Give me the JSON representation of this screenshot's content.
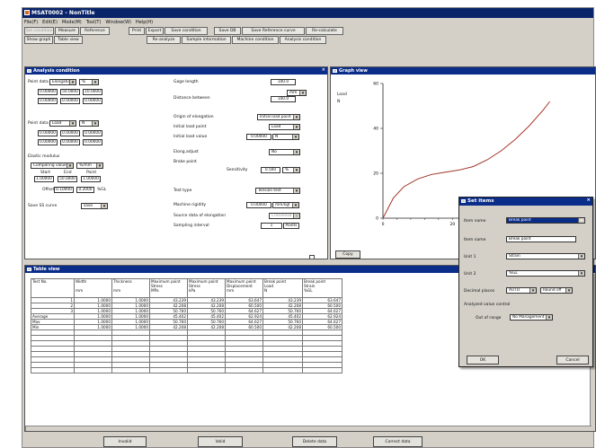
{
  "window": {
    "title": "MSAT0002 - NonTitle"
  },
  "menu": [
    "File(F)",
    "Edit(E)",
    "Mode(M)",
    "Tool(T)",
    "Window(W)",
    "Help(H)"
  ],
  "toolbar1": [
    "Set condition",
    "Measure",
    "Reference",
    "Print",
    "Export",
    "Save condition",
    "Save DB",
    "Save Reference curve",
    "Re-calculate"
  ],
  "toolbar2": [
    "Show graph",
    "Table view",
    "Re-analyze",
    "Sample information",
    "Machine condition",
    "Analysis condition"
  ],
  "analysis": {
    "title": "Analysis condition",
    "point1": {
      "label": "Point data",
      "type": "Elongation",
      "unit": "%",
      "v1": "0.00000",
      "v2": "50.0000",
      "v3": "10.0000",
      "v4": "0.00000",
      "v5": "0.00000",
      "v6": "0.00000"
    },
    "point2": {
      "label": "Point data",
      "type": "Load",
      "unit": "N",
      "v1": "0.00000",
      "v2": "0.00000",
      "v3": "0.00000",
      "v4": "0.00000",
      "v5": "0.00000",
      "v6": "0.00000"
    },
    "elastic": {
      "label": "Elastic modulus",
      "type": "Comparing value",
      "range": "%/mm",
      "start_label": "Start",
      "end_label": "End",
      "point_label": "Point",
      "start": "1.00000",
      "end": "50.0000",
      "point": "1.00000",
      "offset_label": "Offset",
      "offset": "0.10000",
      "offset2": "0.2000",
      "offset_unit": "%GL"
    },
    "save_curve": {
      "label": "Save SS curve",
      "value": "save"
    },
    "gage_length": {
      "label": "Gage length",
      "value": "100.0"
    },
    "distance": {
      "label": "Distance between",
      "value": "100.0",
      "unit": "mm"
    },
    "origin": {
      "label": "Origin of elongation",
      "value": "Initial load point"
    },
    "initial_load_point": {
      "label": "Initial load point",
      "value": "Load"
    },
    "initial_load_value": {
      "label": "Initial load value",
      "value": "0.00000",
      "unit": "N"
    },
    "elong_adjust": {
      "label": "Elong.adjust",
      "value": "No"
    },
    "break_point": {
      "label": "Brake point"
    },
    "sensitivity": {
      "label": "Sensitivity",
      "value": "0.500",
      "unit": "%"
    },
    "test_type": {
      "label": "Test type",
      "value": "Tension test"
    },
    "rigidity": {
      "label": "Machine rigidity",
      "value": "0.00000",
      "unit": "mm/kgf"
    },
    "source": {
      "label": "Source data of elongation",
      "value": "Crosshead"
    },
    "sampling": {
      "label": "Sampling interval",
      "value": "1",
      "unit": "Points"
    }
  },
  "graph": {
    "title": "Graph view",
    "ylabel": "Load",
    "yunit": "N",
    "copy_label": "Copy"
  },
  "chart_data": {
    "type": "line",
    "title": "",
    "xlabel": "",
    "ylabel": "Load N",
    "x_ticks": [
      "0",
      "20"
    ],
    "y_ticks": [
      "0",
      "20",
      "40",
      "60"
    ],
    "ylim": [
      0,
      60
    ],
    "xlim": [
      0,
      60
    ],
    "series": [
      {
        "name": "",
        "x": [
          0,
          3,
          6,
          10,
          14,
          18,
          22,
          26,
          30,
          34,
          38,
          42,
          46,
          48
        ],
        "y": [
          0,
          9,
          14,
          17.5,
          19.5,
          20.5,
          21.5,
          23,
          26,
          30,
          35,
          41,
          48,
          52
        ]
      }
    ],
    "grid": false
  },
  "table": {
    "title": "Table view",
    "headers": [
      [
        "Test No.",
        "",
        ""
      ],
      [
        "Width",
        "",
        "mm"
      ],
      [
        "Thickness",
        "",
        "mm"
      ],
      [
        "Maximum point",
        "Stress",
        "MPa"
      ],
      [
        "Maximum point",
        "Stress",
        "kPa"
      ],
      [
        "Maximum point",
        "Displacement",
        "mm"
      ],
      [
        "Break point",
        "Load",
        "N"
      ],
      [
        "Break point",
        "Strain",
        "%GL"
      ]
    ],
    "rows": [
      [
        "1",
        "1.0000",
        "1.0000",
        "43.239",
        "43.239",
        "63.647",
        "43.239",
        "63.647"
      ],
      [
        "2",
        "1.0000",
        "1.0000",
        "42.208",
        "42.208",
        "60.500",
        "42.208",
        "60.500"
      ],
      [
        "3",
        "1.0000",
        "1.0000",
        "50.760",
        "50.760",
        "64.627",
        "50.760",
        "64.627"
      ],
      [
        "Average",
        "1.0000",
        "1.0000",
        "45.402",
        "45.402",
        "62.924",
        "45.402",
        "62.924"
      ],
      [
        "Max",
        "1.0000",
        "1.0000",
        "50.760",
        "50.760",
        "64.627",
        "50.760",
        "64.627"
      ],
      [
        "Min",
        "1.0000",
        "1.0000",
        "42.208",
        "42.208",
        "60.500",
        "42.208",
        "60.500"
      ]
    ]
  },
  "bottom_buttons": [
    "Invalid",
    "Valid",
    "Delete data",
    "Correct data"
  ],
  "dialog": {
    "title": "Set items",
    "item_name_label": "Item name",
    "item_name": "Break point",
    "item_name2_label": "Item name",
    "item_name2": "Break point",
    "unit1_label": "Unit 1",
    "unit1": "Strain",
    "unit2_label": "Unit 2",
    "unit2": "%GL",
    "decimal_label": "Decimal places",
    "decimal": "AUTO",
    "rounding": "Round off",
    "analyzed_label": "Analyzed value control",
    "outrange_label": "Out of range",
    "outrange": "No Management",
    "ok": "OK",
    "cancel": "Cancel"
  }
}
